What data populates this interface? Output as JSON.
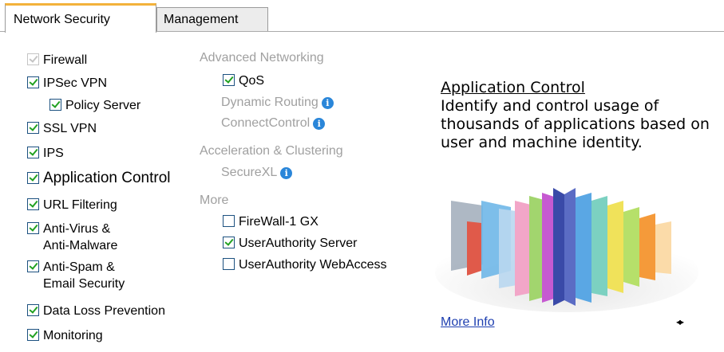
{
  "tabs": [
    {
      "label": "Network Security",
      "active": true
    },
    {
      "label": "Management",
      "active": false
    }
  ],
  "left_blades": {
    "firewall": {
      "label": "Firewall",
      "checked": true,
      "disabled": true
    },
    "ipsec_vpn": {
      "label": "IPSec VPN",
      "checked": true
    },
    "policy_server": {
      "label": "Policy Server",
      "checked": true
    },
    "ssl_vpn": {
      "label": "SSL VPN",
      "checked": true
    },
    "ips": {
      "label": "IPS",
      "checked": true
    },
    "app_control": {
      "label": "Application Control",
      "checked": true
    },
    "url_filtering": {
      "label": "URL Filtering",
      "checked": true
    },
    "anti_virus": {
      "label_line1": "Anti-Virus &",
      "label_line2": "Anti-Malware",
      "checked": true
    },
    "anti_spam": {
      "label_line1": "Anti-Spam &",
      "label_line2": "Email Security",
      "checked": true
    },
    "dlp": {
      "label": "Data Loss Prevention",
      "checked": true
    },
    "monitoring": {
      "label": "Monitoring",
      "checked": true
    }
  },
  "advanced_networking": {
    "heading": "Advanced Networking",
    "qos": {
      "label": "QoS",
      "checked": true
    },
    "dynamic_routing": "Dynamic Routing",
    "connect_control": "ConnectControl"
  },
  "acceleration": {
    "heading": "Acceleration & Clustering",
    "securexl": "SecureXL"
  },
  "more_group": {
    "heading": "More",
    "firewall1_gx": {
      "label": "FireWall-1 GX",
      "checked": false
    },
    "ua_server": {
      "label": "UserAuthority Server",
      "checked": true
    },
    "ua_webaccess": {
      "label": "UserAuthority WebAccess",
      "checked": false
    }
  },
  "description": {
    "title": "Application Control",
    "text": "Identify and control usage of thousands of applications based on user and machine identity."
  },
  "more_info": "More Info",
  "info_glyph": "i",
  "nav_arrows": "◂▸",
  "colors": {
    "accent_tab": "#f3b23b",
    "check": "#21a121",
    "link": "#1e3fb0",
    "info": "#2a86d9"
  }
}
